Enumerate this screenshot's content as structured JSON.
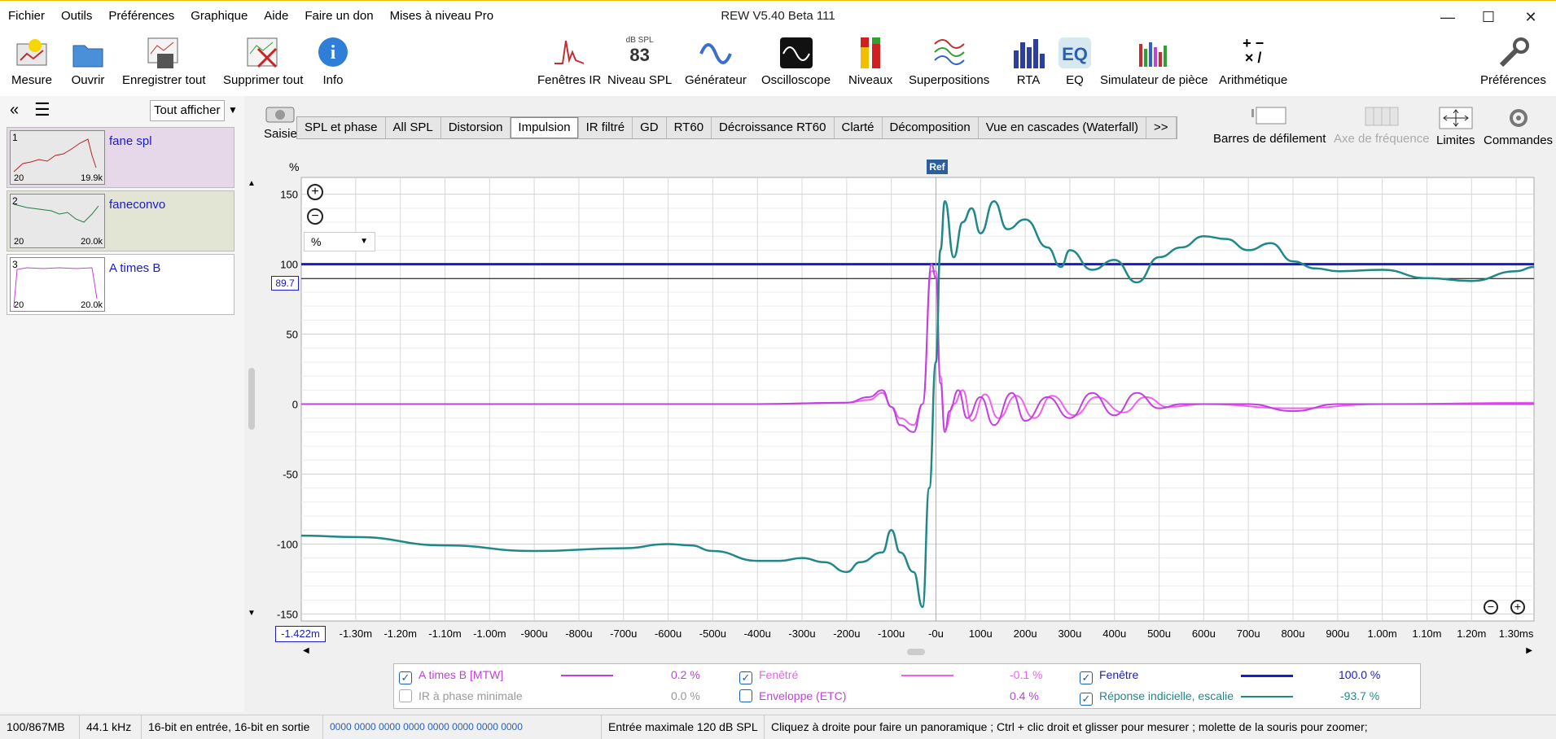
{
  "menu": [
    "Fichier",
    "Outils",
    "Préférences",
    "Graphique",
    "Aide",
    "Faire un don",
    "Mises à niveau Pro"
  ],
  "app_title": "REW V5.40 Beta 111",
  "toolbar": {
    "mesure": "Mesure",
    "ouvrir": "Ouvrir",
    "enregistrer": "Enregistrer tout",
    "supprimer": "Supprimer tout",
    "info": "Info",
    "fenetres_ir": "Fenêtres IR",
    "niveau_spl": "Niveau SPL",
    "spl_unit": "dB SPL",
    "spl_value": "83",
    "generateur": "Générateur",
    "oscilloscope": "Oscilloscope",
    "niveaux": "Niveaux",
    "superpositions": "Superpositions",
    "rta": "RTA",
    "eq": "EQ",
    "simulateur": "Simulateur de pièce",
    "arithmetique": "Arithmétique",
    "preferences": "Préférences"
  },
  "left": {
    "show_all": "Tout afficher",
    "measurements": [
      {
        "num": "1",
        "name": "fane spl",
        "lo": "20",
        "hi": "19.9k",
        "bg": "#e6d8e8"
      },
      {
        "num": "2",
        "name": "faneconvo",
        "lo": "20",
        "hi": "20.0k",
        "bg": "#e2e4d4"
      },
      {
        "num": "3",
        "name": "A times B",
        "lo": "20",
        "hi": "20.0k",
        "bg": "#ffffff"
      }
    ]
  },
  "capture_label": "Saisie",
  "tabs": [
    "SPL et phase",
    "All SPL",
    "Distorsion",
    "Impulsion",
    "IR filtré",
    "GD",
    "RT60",
    "Décroissance RT60",
    "Clarté",
    "Décomposition",
    "Vue en cascades (Waterfall)",
    ">>"
  ],
  "active_tab": "Impulsion",
  "right_tools": {
    "scrollbars": "Barres de défilement",
    "freq_axis": "Axe de fréquence",
    "limits": "Limites",
    "commands": "Commandes"
  },
  "chart_data": {
    "type": "line",
    "ylabel": "%",
    "y_unit_select": "%",
    "yticks": [
      "150",
      "100",
      "50",
      "0",
      "-50",
      "-100",
      "-150"
    ],
    "ylim": [
      -155,
      162
    ],
    "xticks": [
      "-1.30m",
      "-1.20m",
      "-1.10m",
      "-1.00m",
      "-900u",
      "-800u",
      "-700u",
      "-600u",
      "-500u",
      "-400u",
      "-300u",
      "-200u",
      "-100u",
      "-0u",
      "100u",
      "200u",
      "300u",
      "400u",
      "500u",
      "600u",
      "700u",
      "800u",
      "900u",
      "1.00m",
      "1.10m",
      "1.20m",
      "1.30ms"
    ],
    "xlim_ms": [
      -1.422,
      1.34
    ],
    "x_start_label": "-1.422m",
    "ref_label": "Ref",
    "cursor_value": "89.7",
    "cursor_y": 89.7,
    "series": [
      {
        "name": "A times B [MTW]",
        "color": "#c040e0",
        "legend_value": "0.2 %"
      },
      {
        "name": "Fenêtré",
        "color": "#f060f0",
        "legend_value": "-0.1 %"
      },
      {
        "name": "Fenêtre",
        "color": "#1a1ad0",
        "legend_value": "100.0 %",
        "level": 100
      },
      {
        "name": "IR à phase minimale",
        "color": "#999999",
        "legend_value": "0.0 %"
      },
      {
        "name": "Enveloppe (ETC)",
        "color": "#c040e0",
        "legend_value": "0.4 %"
      },
      {
        "name": "Réponse indicielle, escalie",
        "color": "#208888",
        "legend_value": "-93.7 %"
      }
    ],
    "step_response": [
      [
        -1.422,
        -94
      ],
      [
        -1.3,
        -95
      ],
      [
        -1.1,
        -101
      ],
      [
        -0.9,
        -105
      ],
      [
        -0.7,
        -103
      ],
      [
        -0.6,
        -100
      ],
      [
        -0.55,
        -101
      ],
      [
        -0.5,
        -105
      ],
      [
        -0.4,
        -112
      ],
      [
        -0.35,
        -112
      ],
      [
        -0.3,
        -110
      ],
      [
        -0.25,
        -113
      ],
      [
        -0.2,
        -120
      ],
      [
        -0.17,
        -113
      ],
      [
        -0.12,
        -106
      ],
      [
        -0.1,
        -90
      ],
      [
        -0.08,
        -106
      ],
      [
        -0.05,
        -120
      ],
      [
        -0.03,
        -145
      ],
      [
        -0.015,
        -60
      ],
      [
        0.0,
        30
      ],
      [
        0.01,
        110
      ],
      [
        0.02,
        145
      ],
      [
        0.04,
        105
      ],
      [
        0.06,
        130
      ],
      [
        0.08,
        140
      ],
      [
        0.1,
        122
      ],
      [
        0.13,
        145
      ],
      [
        0.16,
        125
      ],
      [
        0.2,
        132
      ],
      [
        0.25,
        112
      ],
      [
        0.28,
        98
      ],
      [
        0.3,
        110
      ],
      [
        0.35,
        96
      ],
      [
        0.4,
        103
      ],
      [
        0.45,
        87
      ],
      [
        0.5,
        105
      ],
      [
        0.55,
        112
      ],
      [
        0.6,
        120
      ],
      [
        0.65,
        118
      ],
      [
        0.7,
        110
      ],
      [
        0.75,
        115
      ],
      [
        0.8,
        102
      ],
      [
        0.85,
        97
      ],
      [
        0.9,
        95
      ],
      [
        1.0,
        96
      ],
      [
        1.1,
        90
      ],
      [
        1.2,
        88
      ],
      [
        1.3,
        95
      ],
      [
        1.34,
        98
      ]
    ],
    "impulse_b": [
      [
        -1.422,
        0
      ],
      [
        -0.4,
        0
      ],
      [
        -0.2,
        1
      ],
      [
        -0.15,
        5
      ],
      [
        -0.12,
        10
      ],
      [
        -0.1,
        -2
      ],
      [
        -0.08,
        -15
      ],
      [
        -0.05,
        -20
      ],
      [
        -0.03,
        0
      ],
      [
        -0.01,
        100
      ],
      [
        0.0,
        90
      ],
      [
        0.01,
        15
      ],
      [
        0.02,
        -20
      ],
      [
        0.03,
        -5
      ],
      [
        0.05,
        10
      ],
      [
        0.07,
        -10
      ],
      [
        0.1,
        5
      ],
      [
        0.13,
        -15
      ],
      [
        0.17,
        8
      ],
      [
        0.2,
        -12
      ],
      [
        0.25,
        5
      ],
      [
        0.3,
        -10
      ],
      [
        0.35,
        8
      ],
      [
        0.4,
        -8
      ],
      [
        0.45,
        8
      ],
      [
        0.5,
        -3
      ],
      [
        0.55,
        0
      ],
      [
        0.7,
        0
      ],
      [
        0.8,
        -5
      ],
      [
        0.9,
        0
      ],
      [
        1.34,
        0
      ]
    ],
    "impulse_w": [
      [
        -1.422,
        0
      ],
      [
        -0.4,
        0
      ],
      [
        -0.2,
        1
      ],
      [
        -0.15,
        3
      ],
      [
        -0.12,
        8
      ],
      [
        -0.1,
        -2
      ],
      [
        -0.08,
        -10
      ],
      [
        -0.05,
        -15
      ],
      [
        -0.03,
        0
      ],
      [
        -0.01,
        95
      ],
      [
        0.0,
        95
      ],
      [
        0.01,
        20
      ],
      [
        0.02,
        -18
      ],
      [
        0.04,
        0
      ],
      [
        0.06,
        10
      ],
      [
        0.08,
        -12
      ],
      [
        0.11,
        7
      ],
      [
        0.14,
        -10
      ],
      [
        0.18,
        6
      ],
      [
        0.22,
        -10
      ],
      [
        0.26,
        6
      ],
      [
        0.31,
        -8
      ],
      [
        0.36,
        5
      ],
      [
        0.42,
        -6
      ],
      [
        0.47,
        5
      ],
      [
        0.52,
        -2
      ],
      [
        0.6,
        0
      ],
      [
        0.8,
        -3
      ],
      [
        1.0,
        0
      ],
      [
        1.34,
        1
      ]
    ]
  },
  "legend": {
    "a_times_b": "A times B [MTW]",
    "a_times_b_val": "0.2 %",
    "fenetre_d": "Fenêtré",
    "fenetre_d_val": "-0.1 %",
    "fenetre": "Fenêtre",
    "fenetre_val": "100.0 %",
    "ir_min": "IR à phase minimale",
    "ir_min_val": "0.0 %",
    "enveloppe": "Enveloppe (ETC)",
    "enveloppe_val": "0.4 %",
    "reponse": "Réponse indicielle, escalie",
    "reponse_val": "-93.7 %"
  },
  "status": [
    "100/867MB",
    "44.1 kHz",
    "16-bit en entrée, 16-bit en sortie",
    "0000 0000  0000 0000  0000 0000  0000 0000",
    "Entrée maximale 120 dB SPL",
    "Cliquez à droite pour faire un panoramique ; Ctrl + clic droit et glisser pour mesurer ; molette de la souris pour zoomer;"
  ]
}
